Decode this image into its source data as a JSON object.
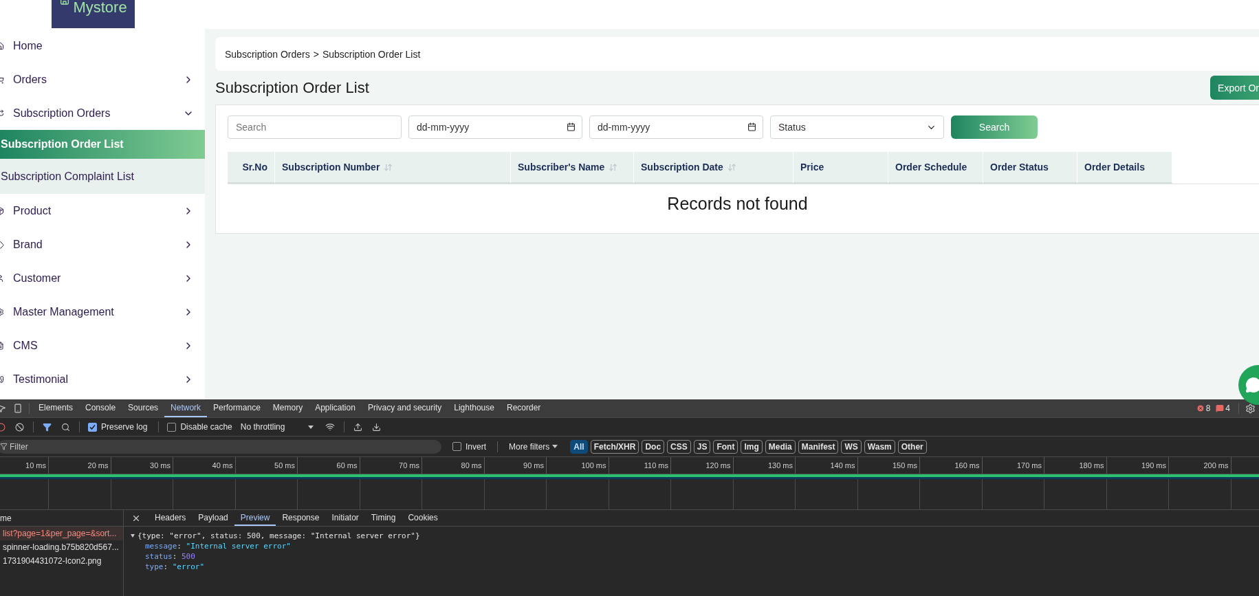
{
  "header": {
    "logo_text": "Mystore"
  },
  "sidebar": {
    "items": [
      {
        "label": "Home",
        "selected": false
      },
      {
        "label": "Orders",
        "selected": false,
        "expanded": false
      },
      {
        "label": "Subscription Orders",
        "selected": false,
        "expanded": true,
        "children": [
          {
            "label": "Subscription Order List",
            "selected": true
          },
          {
            "label": "Subscription Complaint List",
            "selected": false
          }
        ]
      },
      {
        "label": "Product",
        "selected": false,
        "expanded": false
      },
      {
        "label": "Brand",
        "selected": false,
        "expanded": false
      },
      {
        "label": "Customer",
        "selected": false,
        "expanded": false
      },
      {
        "label": "Master Management",
        "selected": false,
        "expanded": false
      },
      {
        "label": "CMS",
        "selected": false,
        "expanded": false
      },
      {
        "label": "Testimonial",
        "selected": false,
        "expanded": false
      }
    ]
  },
  "breadcrumb": {
    "items": [
      "Subscription Orders",
      "Subscription Order List"
    ],
    "separator": ">"
  },
  "page_title": "Subscription Order List",
  "export_button": "Export Or",
  "filters": {
    "search": {
      "placeholder": "Search"
    },
    "date_from": {
      "placeholder": "dd-mm-yyyy"
    },
    "date_to": {
      "placeholder": "dd-mm-yyyy"
    },
    "status": {
      "value": "Status"
    },
    "search_button": "Search"
  },
  "table": {
    "columns": [
      {
        "label": "Sr.No",
        "sortable": false
      },
      {
        "label": "Subscription Number",
        "sortable": true
      },
      {
        "label": "Subscriber's Name",
        "sortable": true
      },
      {
        "label": "Subscription Date",
        "sortable": true
      },
      {
        "label": "Price",
        "sortable": false
      },
      {
        "label": "Order Schedule",
        "sortable": false
      },
      {
        "label": "Order Status",
        "sortable": false
      },
      {
        "label": "Order Details",
        "sortable": false
      }
    ],
    "empty_message": "Records not found"
  },
  "devtools": {
    "tabs": [
      {
        "label": "Elements",
        "selected": false
      },
      {
        "label": "Console",
        "selected": false
      },
      {
        "label": "Sources",
        "selected": false
      },
      {
        "label": "Network",
        "selected": true
      },
      {
        "label": "Performance",
        "selected": false
      },
      {
        "label": "Memory",
        "selected": false
      },
      {
        "label": "Application",
        "selected": false
      },
      {
        "label": "Privacy and security",
        "selected": false
      },
      {
        "label": "Lighthouse",
        "selected": false
      },
      {
        "label": "Recorder",
        "selected": false
      }
    ],
    "error_count": "8",
    "warning_count": "4",
    "preserve_log": {
      "label": "Preserve log",
      "checked": true
    },
    "disable_cache": {
      "label": "Disable cache",
      "checked": false
    },
    "throttling": "No throttling",
    "filter": {
      "placeholder": "Filter"
    },
    "invert": {
      "label": "Invert",
      "checked": false
    },
    "more_filters": "More filters",
    "type_chips": [
      {
        "label": "All",
        "selected": true
      },
      {
        "label": "Fetch/XHR",
        "selected": false
      },
      {
        "label": "Doc",
        "selected": false
      },
      {
        "label": "CSS",
        "selected": false
      },
      {
        "label": "JS",
        "selected": false
      },
      {
        "label": "Font",
        "selected": false
      },
      {
        "label": "Img",
        "selected": false
      },
      {
        "label": "Media",
        "selected": false
      },
      {
        "label": "Manifest",
        "selected": false
      },
      {
        "label": "WS",
        "selected": false
      },
      {
        "label": "Wasm",
        "selected": false
      },
      {
        "label": "Other",
        "selected": false
      }
    ],
    "ruler_ticks": [
      "10 ms",
      "20 ms",
      "30 ms",
      "40 ms",
      "50 ms",
      "60 ms",
      "70 ms",
      "80 ms",
      "90 ms",
      "100 ms",
      "110 ms",
      "120 ms",
      "130 ms",
      "140 ms",
      "150 ms",
      "160 ms",
      "170 ms",
      "180 ms",
      "190 ms",
      "200 ms"
    ],
    "requests": {
      "column_header": "me",
      "rows": [
        {
          "name": "list?page=1&per_page=&sort...",
          "selected": true,
          "failed": true
        },
        {
          "name": "spinner-loading.b75b820d567...",
          "selected": false,
          "failed": false
        },
        {
          "name": "1731904431072-Icon2.png",
          "selected": false,
          "failed": false
        }
      ]
    },
    "detail_tabs": [
      {
        "label": "Headers",
        "selected": false
      },
      {
        "label": "Payload",
        "selected": false
      },
      {
        "label": "Preview",
        "selected": true
      },
      {
        "label": "Response",
        "selected": false
      },
      {
        "label": "Initiator",
        "selected": false
      },
      {
        "label": "Timing",
        "selected": false
      },
      {
        "label": "Cookies",
        "selected": false
      }
    ],
    "preview": {
      "separator": ":",
      "summary": "{type: \"error\", status: 500, message: \"Internal server error\"}",
      "expanded": true,
      "fields": [
        {
          "key": "message",
          "value": "\"Internal server error\"",
          "kind": "string"
        },
        {
          "key": "status",
          "value": "500",
          "kind": "number"
        },
        {
          "key": "type",
          "value": "\"error\"",
          "kind": "string"
        }
      ]
    }
  }
}
